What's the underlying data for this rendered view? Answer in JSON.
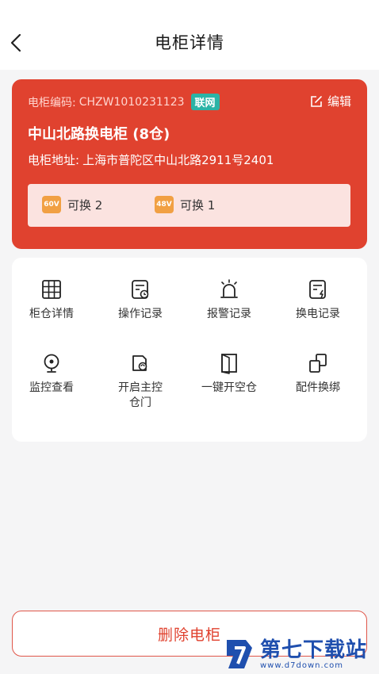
{
  "header": {
    "title": "电柜详情"
  },
  "cabinet": {
    "code_label": "电柜编码:",
    "code": "CHZW1010231123",
    "status": "联网",
    "edit_label": "编辑",
    "name": "中山北路换电柜 (8仓)",
    "address_label": "电柜地址:",
    "address": "上海市普陀区中山北路2911号2401",
    "swaps": [
      {
        "voltage": "60V",
        "label": "可换 2"
      },
      {
        "voltage": "48V",
        "label": "可换 1"
      }
    ]
  },
  "functions": [
    {
      "label": "柜仓详情",
      "icon": "grid-icon"
    },
    {
      "label": "操作记录",
      "icon": "operation-log-icon"
    },
    {
      "label": "报警记录",
      "icon": "alarm-icon"
    },
    {
      "label": "换电记录",
      "icon": "swap-log-icon"
    },
    {
      "label": "监控查看",
      "icon": "camera-icon"
    },
    {
      "label": "开启主控\n仓门",
      "icon": "open-door-icon"
    },
    {
      "label": "一键开空仓",
      "icon": "door-icon"
    },
    {
      "label": "配件换绑",
      "icon": "rebind-icon"
    }
  ],
  "delete_label": "删除电柜",
  "watermark": {
    "name": "第七下载站",
    "url": "www.d7down.com"
  },
  "colors": {
    "accent": "#e0422f",
    "online": "#2bb3a6",
    "voltage": "#f1a043"
  }
}
